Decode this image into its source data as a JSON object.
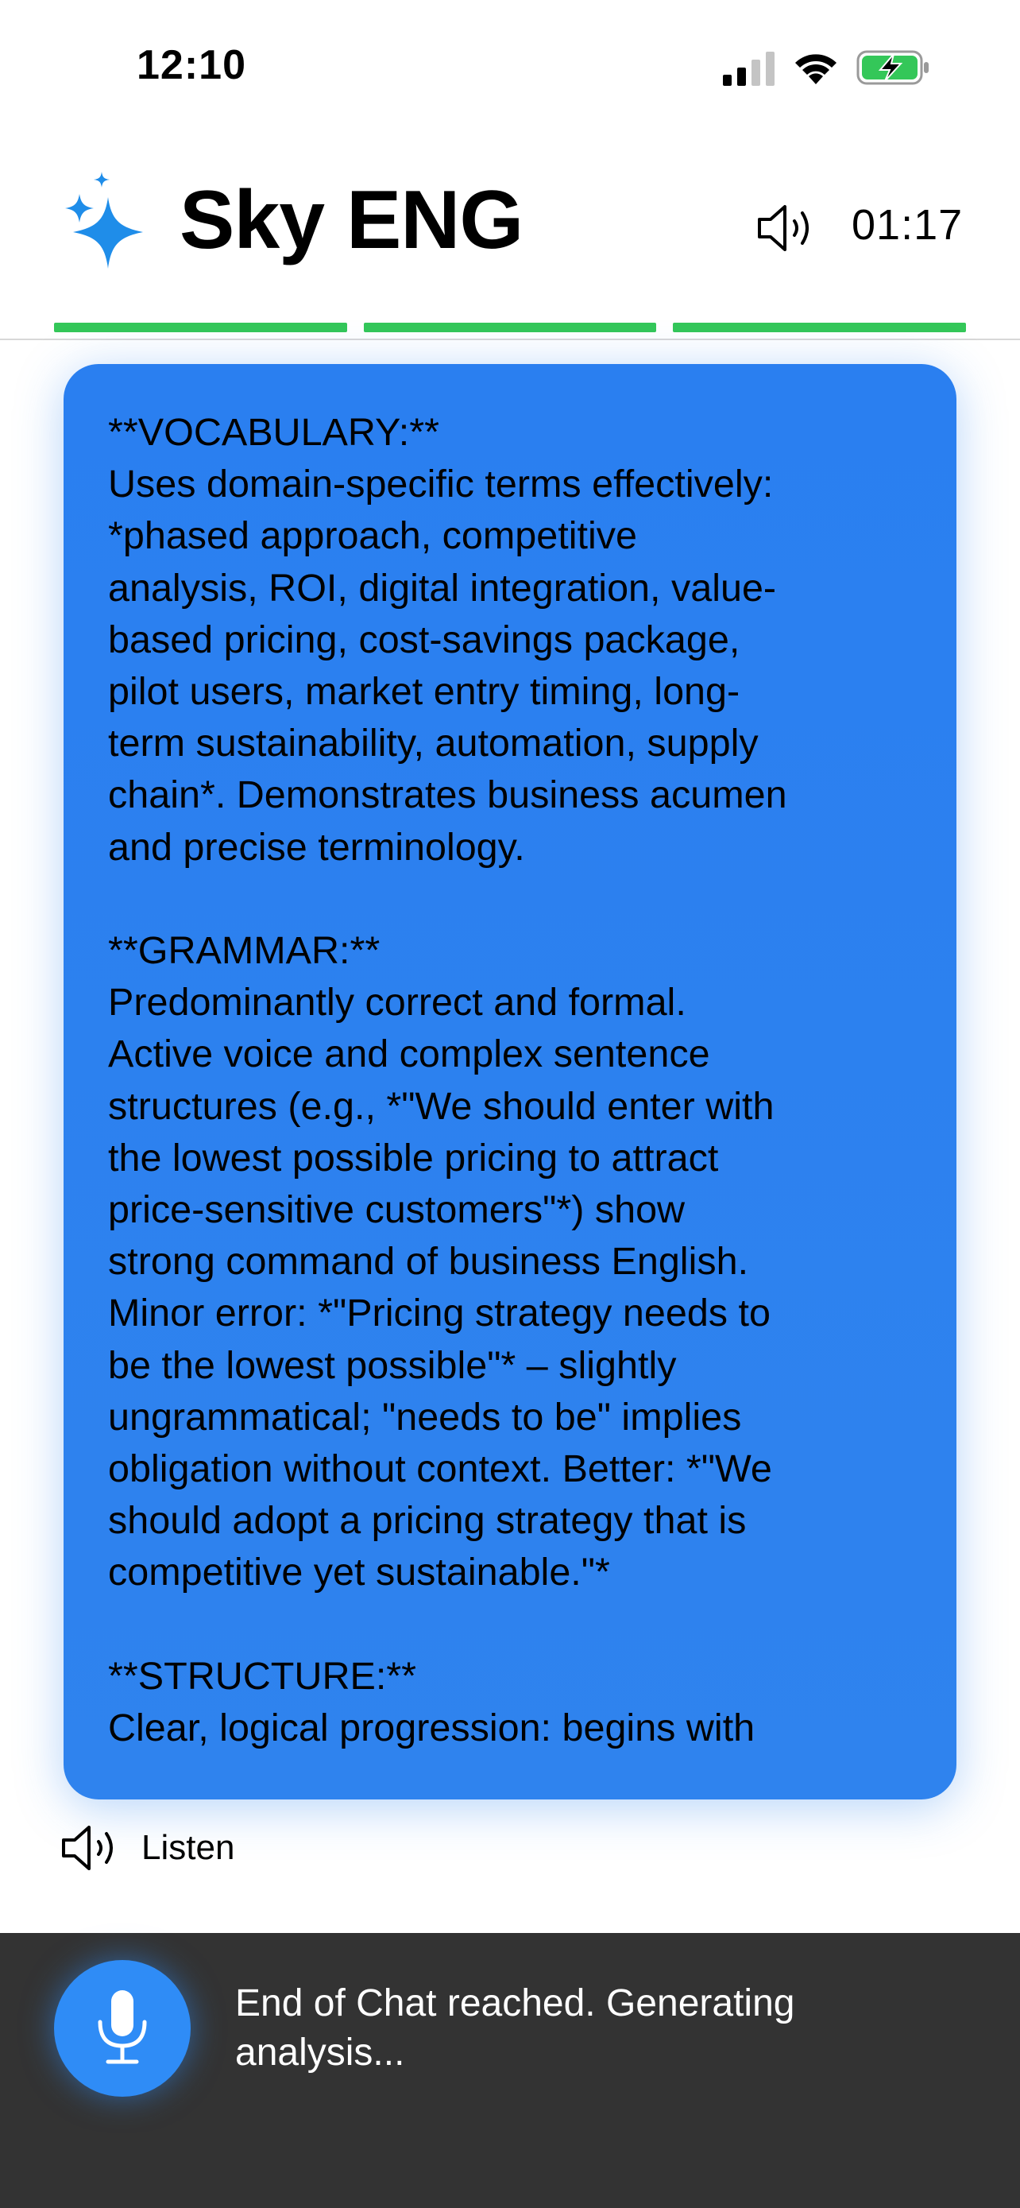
{
  "status_bar": {
    "time": "12:10"
  },
  "header": {
    "title": "Sky ENG",
    "timer": "01:17"
  },
  "progress": {
    "completed_segments": 3,
    "total_segments": 3
  },
  "colors": {
    "accent_blue": "#2f83ee",
    "progress_green": "#34c759",
    "logo_blue": "#1f8de9",
    "bottom_bar": "#333333"
  },
  "message": {
    "text": "**VOCABULARY:**\nUses domain-specific terms effectively:\n*phased approach, competitive\nanalysis, ROI, digital integration, value-\nbased pricing, cost-savings package,\npilot users, market entry timing, long-\nterm sustainability, automation, supply\nchain*. Demonstrates business acumen\nand precise terminology.\n\n**GRAMMAR:**\nPredominantly correct and formal.\nActive voice and complex sentence\nstructures (e.g., *\"We should enter with\nthe lowest possible pricing to attract\nprice-sensitive customers\"*) show\nstrong command of business English.\nMinor error: *\"Pricing strategy needs to\nbe the lowest possible\"* – slightly\nungrammatical; \"needs to be\" implies\nobligation without context. Better: *\"We\nshould adopt a pricing strategy that is\ncompetitive yet sustainable.\"*\n\n**STRUCTURE:**\nClear, logical progression: begins with",
    "listen_label": "Listen"
  },
  "bottom_bar": {
    "status": "End of Chat reached. Generating analysis..."
  },
  "icons": {
    "logo": "sparkles-icon",
    "speaker": "speaker-wave-icon",
    "mic": "microphone-icon"
  }
}
